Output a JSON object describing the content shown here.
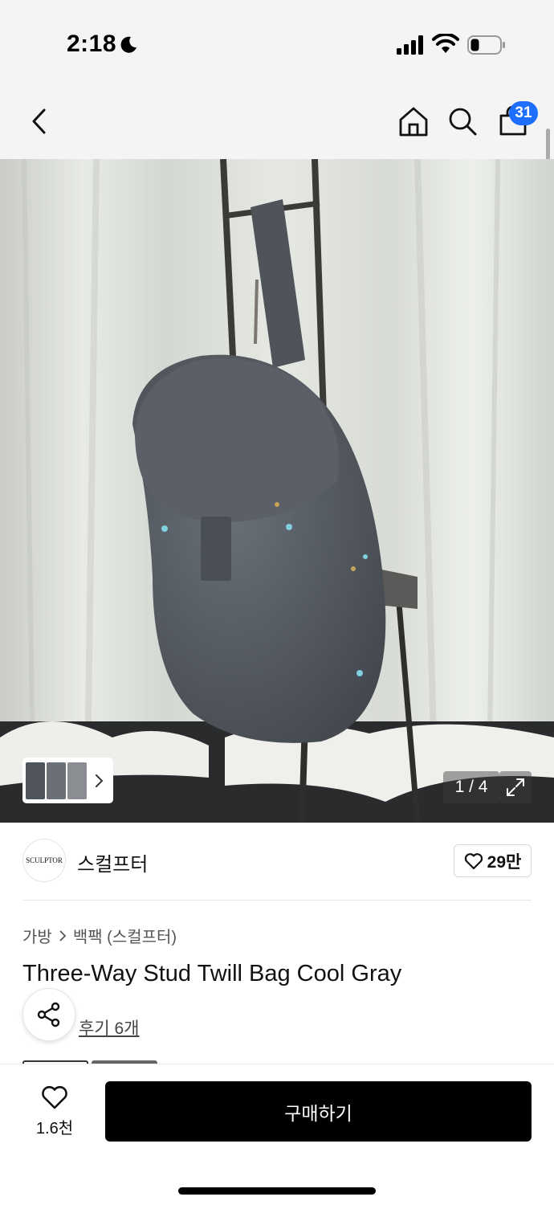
{
  "status_bar": {
    "time": "2:18",
    "icons": [
      "moon-icon",
      "cellular-signal-icon",
      "wifi-icon",
      "battery-icon"
    ]
  },
  "nav": {
    "icons": [
      "back-chevron-icon",
      "home-icon",
      "search-icon",
      "cart-icon"
    ],
    "cart_count": "31"
  },
  "gallery": {
    "counter": "1 / 4",
    "icons": [
      "thumbnail-next-chevron-icon",
      "expand-icon"
    ]
  },
  "brand": {
    "logo_text": "SCULPTOR",
    "name": "스컬프터",
    "like_count": "29만",
    "like_icon": "heart-outline-icon"
  },
  "breadcrumb": {
    "category": "가방",
    "subcategory": "백팩 (스컬프터)",
    "separator_icon": "chevron-right-icon"
  },
  "product": {
    "title": "Three-Way Stud Twill Bag Cool Gray",
    "review_link": "후기 6개",
    "share_icon": "share-icon"
  },
  "bottom_bar": {
    "wishlist_count": "1.6천",
    "buy_label": "구매하기"
  },
  "colors": {
    "accent_badge": "#1f6fff",
    "buy_button": "#000000",
    "header_bg": "#f4f4f4"
  }
}
